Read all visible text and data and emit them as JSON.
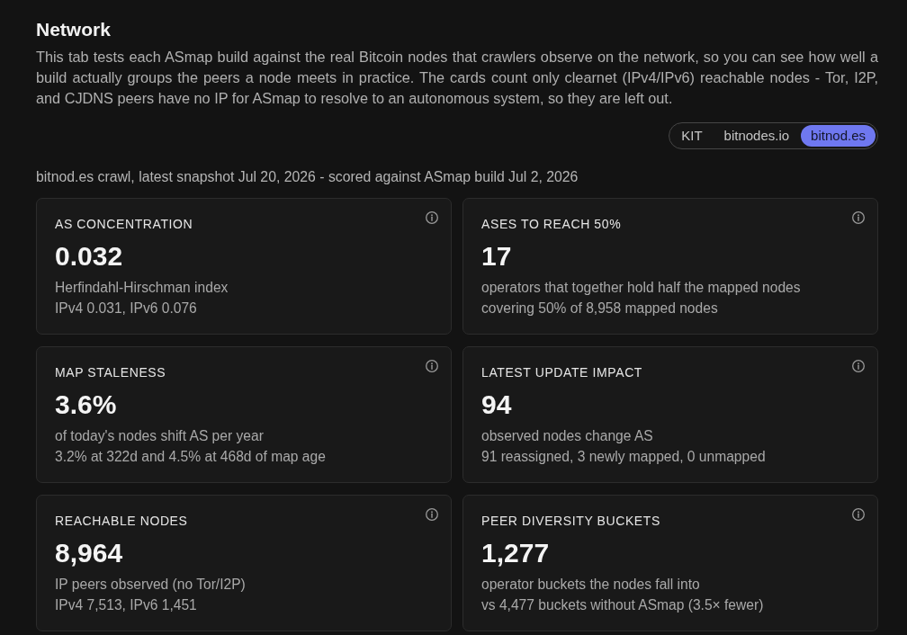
{
  "header": {
    "title": "Network",
    "description": "This tab tests each ASmap build against the real Bitcoin nodes that crawlers observe on the network, so you can see how well a build actually groups the peers a node meets in practice. The cards count only clearnet (IPv4/IPv6) reachable nodes - Tor, I2P, and CJDNS peers have no IP for ASmap to resolve to an autonomous system, so they are left out."
  },
  "source_tabs": [
    {
      "label": "KIT",
      "selected": false
    },
    {
      "label": "bitnodes.io",
      "selected": false
    },
    {
      "label": "bitnod.es",
      "selected": true
    }
  ],
  "caption": "bitnod.es crawl, latest snapshot Jul 20, 2026 - scored against ASmap build Jul 2, 2026",
  "cards": [
    {
      "label": "AS CONCENTRATION",
      "value": "0.032",
      "lines": [
        "Herfindahl-Hirschman index",
        "IPv4 0.031, IPv6 0.076"
      ]
    },
    {
      "label": "ASES TO REACH 50%",
      "value": "17",
      "lines": [
        "operators that together hold half the mapped nodes",
        "covering 50% of 8,958 mapped nodes"
      ]
    },
    {
      "label": "MAP STALENESS",
      "value": "3.6%",
      "lines": [
        "of today's nodes shift AS per year",
        "3.2% at 322d and 4.5% at 468d of map age"
      ]
    },
    {
      "label": "LATEST UPDATE IMPACT",
      "value": "94",
      "lines": [
        "observed nodes change AS",
        "91 reassigned, 3 newly mapped, 0 unmapped"
      ]
    },
    {
      "label": "REACHABLE NODES",
      "value": "8,964",
      "lines": [
        "IP peers observed (no Tor/I2P)",
        "IPv4 7,513, IPv6 1,451"
      ]
    },
    {
      "label": "PEER DIVERSITY BUCKETS",
      "value": "1,277",
      "lines": [
        "operator buckets the nodes fall into",
        "vs 4,477 buckets without ASmap (3.5× fewer)"
      ]
    }
  ]
}
